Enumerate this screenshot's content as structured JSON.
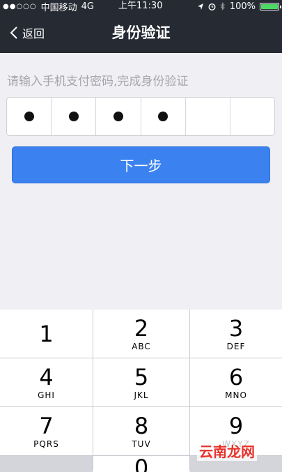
{
  "status_bar": {
    "carrier": "中国移动",
    "network": "4G",
    "time": "上午11:30",
    "battery": "100%",
    "signal_icon": "signal-dots-icon",
    "location_icon": "location-arrow-icon",
    "alarm_icon": "alarm-clock-icon",
    "bluetooth_icon": "bluetooth-icon",
    "battery_color": "#4cd964"
  },
  "nav": {
    "back_label": "返回",
    "title": "身份验证",
    "background": "#262a33"
  },
  "hint": "请输入手机支付密码,完成身份验证",
  "pin": {
    "length": 6,
    "filled": 4
  },
  "next_button": {
    "label": "下一步",
    "color": "#3b82f0"
  },
  "keypad": {
    "keys": [
      {
        "num": "1",
        "letters": ""
      },
      {
        "num": "2",
        "letters": "ABC"
      },
      {
        "num": "3",
        "letters": "DEF"
      },
      {
        "num": "4",
        "letters": "GHI"
      },
      {
        "num": "5",
        "letters": "JKL"
      },
      {
        "num": "6",
        "letters": "MNO"
      },
      {
        "num": "7",
        "letters": "PQRS"
      },
      {
        "num": "8",
        "letters": "TUV"
      },
      {
        "num": "9",
        "letters": "WXYZ"
      },
      {
        "num": "",
        "letters": ""
      },
      {
        "num": "0",
        "letters": ""
      },
      {
        "num": "",
        "letters": ""
      }
    ]
  },
  "watermark": "云南龙网"
}
